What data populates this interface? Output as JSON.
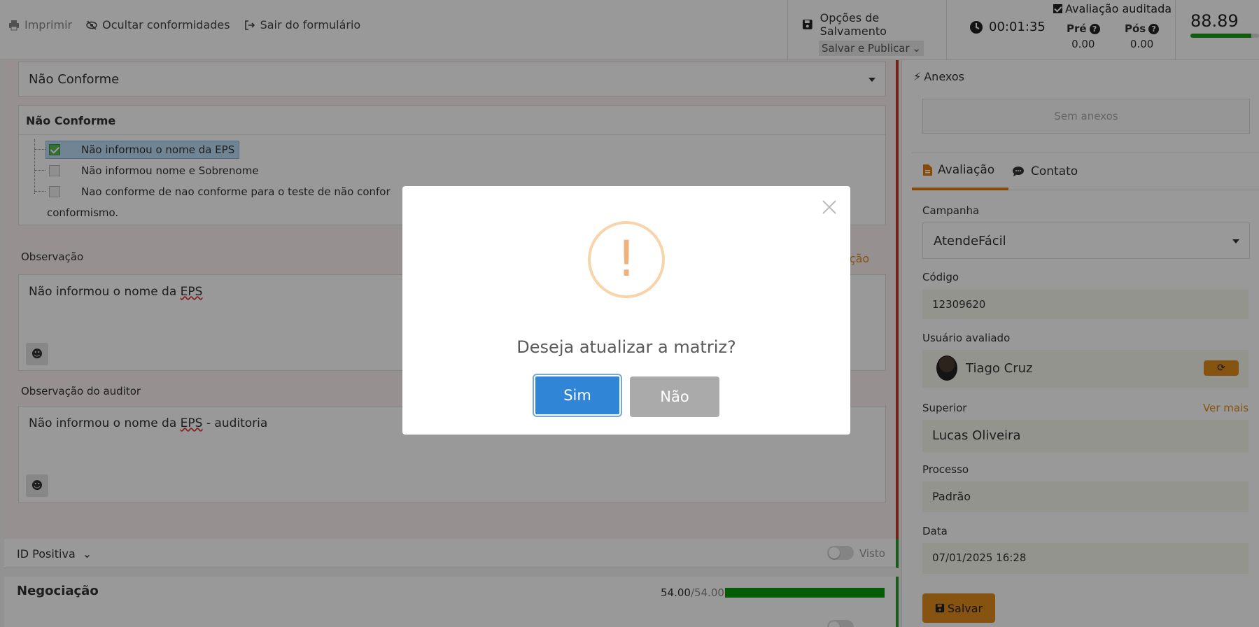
{
  "topbar": {
    "print_label": "Imprimir",
    "hide_label": "Ocultar conformidades",
    "exit_label": "Sair do formulário",
    "save_options_label": "Opções de Salvamento",
    "save_mode_value": "Salvar e Publicar",
    "timer": "00:01:35",
    "audited_label": "Avaliação auditada",
    "pre_label": "Pré",
    "pre_value": "0.00",
    "pos_label": "Pós",
    "pos_value": "0.00",
    "score": "88.89",
    "score_fill_pct": 88.89
  },
  "form": {
    "status_select_value": "Não Conforme",
    "nc_header": "Não Conforme",
    "nc_items": [
      {
        "label": "Não informou o nome da EPS",
        "checked": true
      },
      {
        "label": "Não informou nome e Sobrenome",
        "checked": false
      },
      {
        "label": "Nao conforme de nao conforme para o teste de não confor",
        "checked": false
      }
    ],
    "nc_item_overflow": "conformismo.",
    "observacao_label": "Observação",
    "observacao_link_partial": "ação",
    "observacao_text_prefix": "Não informou o nome da ",
    "observacao_text_eps": "EPS",
    "obs_auditor_label": "Observação do auditor",
    "obs_auditor_text_prefix": "Não informou o nome da ",
    "obs_auditor_text_eps": "EPS",
    "obs_auditor_text_suffix": " - auditoria",
    "id_positiva_label": "ID Positiva",
    "visto_label": "Visto",
    "negociacao_label": "Negociação",
    "negociacao_score": "54.00",
    "negociacao_max": "/54.00",
    "negociacao_fill_pct": 100
  },
  "sidebar": {
    "anexos_label": "Anexos",
    "anexos_empty": "Sem anexos",
    "tab_avaliacao": "Avaliação",
    "tab_contato": "Contato",
    "campanha_label": "Campanha",
    "campanha_value": "AtendeFácil",
    "codigo_label": "Código",
    "codigo_value": "12309620",
    "usuario_label": "Usuário avaliado",
    "usuario_value": "Tiago Cruz",
    "superior_label": "Superior",
    "ver_mais": "Ver mais",
    "superior_value": "Lucas Oliveira",
    "processo_label": "Processo",
    "processo_value": "Padrão",
    "data_label": "Data",
    "data_value": "07/01/2025 16:28",
    "save_label": "Salvar"
  },
  "modal": {
    "icon_glyph": "!",
    "title": "Deseja atualizar a matriz?",
    "confirm_label": "Sim",
    "cancel_label": "Não"
  },
  "colors": {
    "accent_orange": "#e08a1c",
    "confirm_blue": "#3085d6",
    "fail_red": "#c0392b",
    "ok_green": "#2a9a2a"
  }
}
